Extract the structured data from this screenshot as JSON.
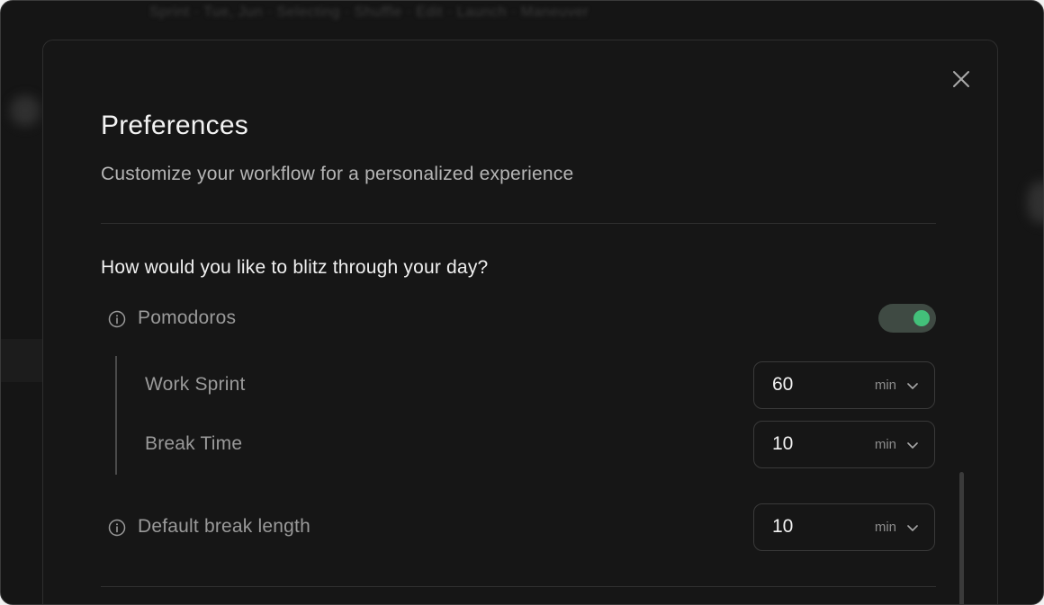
{
  "background": {
    "blurred_text": "Sprint · Tue, Jun · Selecting · Shuffle · Edit · Launch · Maneuver"
  },
  "modal": {
    "title": "Preferences",
    "subtitle": "Customize your workflow for a personalized experience",
    "close_icon": "close-icon"
  },
  "section": {
    "heading": "How would you like to blitz through your day?",
    "pomodoros": {
      "label": "Pomodoros",
      "icon": "info-icon",
      "enabled": true,
      "accent": "#43c07a"
    },
    "work_sprint": {
      "label": "Work Sprint",
      "value": "60",
      "unit": "min"
    },
    "break_time": {
      "label": "Break Time",
      "value": "10",
      "unit": "min"
    },
    "default_break": {
      "label": "Default break length",
      "icon": "info-icon",
      "value": "10",
      "unit": "min"
    }
  }
}
